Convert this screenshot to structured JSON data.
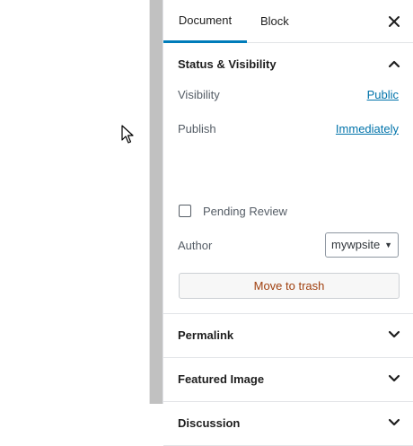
{
  "tabs": {
    "document": "Document",
    "block": "Block"
  },
  "close_icon": "close-icon",
  "status_visibility": {
    "title": "Status & Visibility",
    "expanded": true,
    "visibility_label": "Visibility",
    "visibility_value": "Public",
    "publish_label": "Publish",
    "publish_value": "Immediately",
    "pending_review_label": "Pending Review",
    "pending_review_checked": false,
    "author_label": "Author",
    "author_value": "mywpsite",
    "trash_button": "Move to trash"
  },
  "panels": [
    {
      "title": "Permalink",
      "expanded": false
    },
    {
      "title": "Featured Image",
      "expanded": false
    },
    {
      "title": "Discussion",
      "expanded": false
    }
  ],
  "colors": {
    "accent": "#007cba",
    "link": "#0073aa",
    "trash_text": "#a0400f"
  }
}
